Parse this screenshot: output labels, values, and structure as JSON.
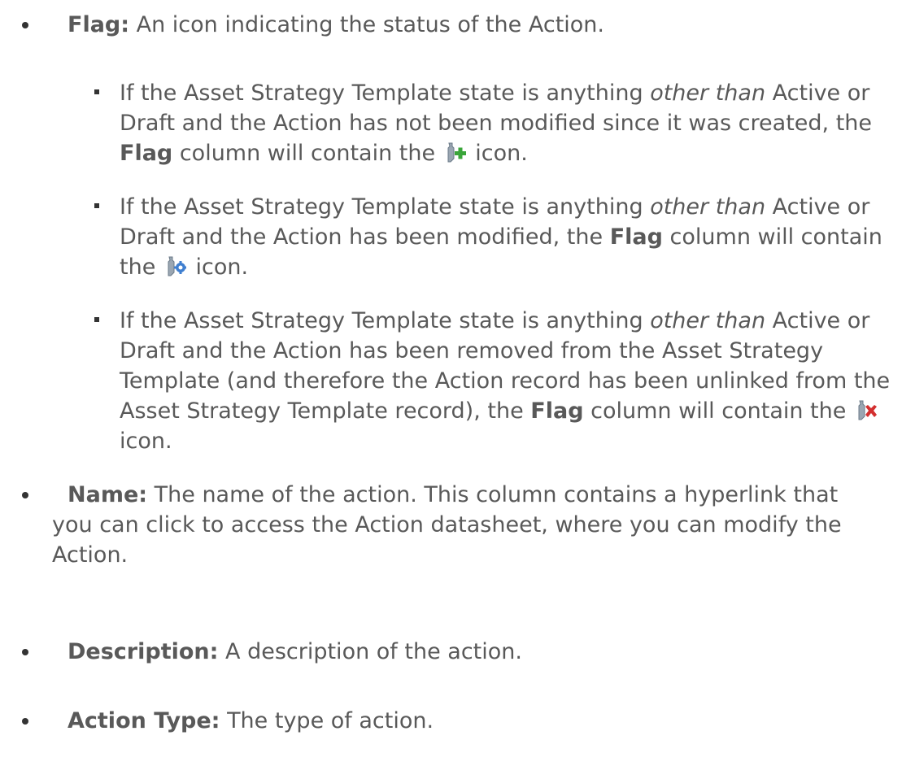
{
  "bullets": [
    {
      "term": "Flag:",
      "desc": " An icon indicating the status of the Action."
    },
    {
      "term": "Name:",
      "desc": " The name of the action. This column contains a hyperlink that you can click to access the Action datasheet, where you can modify the Action."
    },
    {
      "term": "Description:",
      "desc": " A description of the action."
    },
    {
      "term": "Action Type:",
      "desc": " The type of action."
    }
  ],
  "sub_bullets": [
    {
      "lead": "If the Asset Strategy Template state is anything ",
      "emph": "other than",
      "middle": " Active or Draft and the Action has not been modified since it was created, the ",
      "flag": "Flag",
      "before_icon": " column will contain the ",
      "icon": "wrench-plus-icon",
      "after_icon": " icon."
    },
    {
      "lead": "If the Asset Strategy Template state is anything ",
      "emph": "other than",
      "middle": " Active or Draft and the Action has been modified, the ",
      "flag": "Flag",
      "before_icon": " column will contain the ",
      "icon": "wrench-gear-icon",
      "after_icon": " icon."
    },
    {
      "lead": "If the Asset Strategy Template state is anything ",
      "emph": "other than",
      "middle": " Active or Draft and the Action has been removed from the Asset Strategy Template (and therefore the Action record has been unlinked from the Asset Strategy Template record), the ",
      "flag": "Flag",
      "before_icon": " column will contain the ",
      "icon": "wrench-x-icon",
      "after_icon": " icon."
    }
  ]
}
